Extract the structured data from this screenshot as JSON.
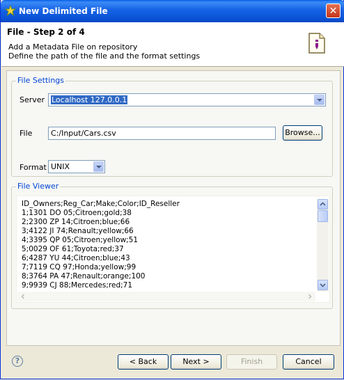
{
  "window": {
    "title": "New Delimited File",
    "close_glyph": "✕"
  },
  "header": {
    "title": "File - Step 2 of 4",
    "description_line1": "Add a Metadata File on repository",
    "description_line2": "Define the path of the file and the format settings"
  },
  "file_settings": {
    "group_label": "File Settings",
    "server_label": "Server",
    "server_value": "Localhost 127.0.0.1",
    "file_label": "File",
    "file_value": "C:/Input/Cars.csv",
    "browse_label": "Browse...",
    "format_label": "Format",
    "format_value": "UNIX"
  },
  "file_viewer": {
    "group_label": "File Viewer",
    "lines": [
      "ID_Owners;Reg_Car;Make;Color;ID_Reseller",
      "1;1301 DO 05;Citroen;gold;38",
      "2;2300 ZP 14;Citroen;blue;66",
      "3;4122 JI 74;Renault;yellow;66",
      "4;3395 QP 05;Citroen;yellow;51",
      "5;0029 OF 61;Toyota;red;37",
      "6;4287 YU 44;Citroen;blue;43",
      "7;7119 CQ 97;Honda;yellow;99",
      "8;3764 PA 47;Renault;orange;100",
      "9;9939 CJ 88;Mercedes;red;71"
    ]
  },
  "footer": {
    "help_glyph": "?",
    "back_label": "< Back",
    "next_label": "Next >",
    "finish_label": "Finish",
    "cancel_label": "Cancel"
  },
  "colors": {
    "titlebar": "#0a54d8",
    "group_label": "#0046d5",
    "selection": "#316ac5"
  }
}
